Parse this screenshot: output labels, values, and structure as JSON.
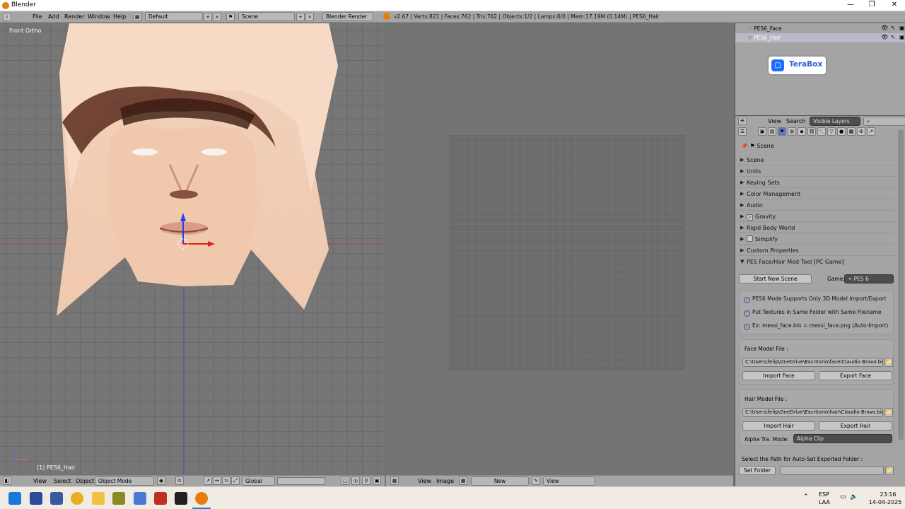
{
  "window": {
    "title": "Blender",
    "min": "—",
    "max": "❐",
    "close": "✕"
  },
  "menus": [
    "File",
    "Add",
    "Render",
    "Window",
    "Help"
  ],
  "layout": "Default",
  "scene": "Scene",
  "engine": "Blender Render",
  "stats": "v2.67 | Verts:821 | Faces:762 | Tris:762 | Objects:1/2 | Lamps:0/0 | Mem:17.19M (0.14M) | PES6_Hair",
  "viewport": {
    "label": "Front Ortho",
    "object_label": "(1) PES6_Hair",
    "menus": [
      "View",
      "Select",
      "Object"
    ],
    "mode": "Object Mode",
    "orientation": "Global"
  },
  "image_editor": {
    "menus": [
      "View",
      "Image"
    ],
    "new_label": "New",
    "view_label": "View"
  },
  "outliner": {
    "items": [
      "PES6_Face",
      "PES6_Hair"
    ]
  },
  "terabox": {
    "label": "TeraBox"
  },
  "properties_header": {
    "menus": [
      "View",
      "Search"
    ],
    "filter": "Visible Layers"
  },
  "properties": {
    "context": "Scene",
    "panels": [
      "Scene",
      "Units",
      "Keying Sets",
      "Color Management",
      "Audio",
      "Gravity",
      "Rigid Body World",
      "Simplify",
      "Custom Properties"
    ],
    "addon": {
      "title": "PES Face/Hair Mod Tool [PC Game]",
      "start_button": "Start New Scene",
      "game_label": "Game:",
      "game_value": "PES 6",
      "info": [
        "PES6 Mode Supports Only 3D Model Import/Export",
        "Put Textures in Same Folder with Same Filename",
        "Ex: messi_face.bin = messi_face.png (Auto-Import)"
      ],
      "face_label": "Face Model File :",
      "face_path": "C:\\Users\\felip\\OneDrive\\Escritorio\\face\\Claudio Bravo.bin",
      "import_face": "Import Face",
      "export_face": "Export Face",
      "hair_label": "Hair Model File :",
      "hair_path": "C:\\Users\\felip\\OneDrive\\Escritorio\\hair\\Claudio Bravo.bin",
      "import_hair": "Import Hair",
      "export_hair": "Export Hair",
      "alpha_label": "Alpha Tra. Mode:",
      "alpha_value": "Alpha Clip",
      "folder_hint": "Select the Path for Auto-Set Exported Folder :",
      "set_folder": "Set Folder"
    }
  },
  "taskbar": {
    "lang1": "ESP",
    "lang2": "LAA",
    "time": "23:16",
    "date": "14-04-2025"
  }
}
